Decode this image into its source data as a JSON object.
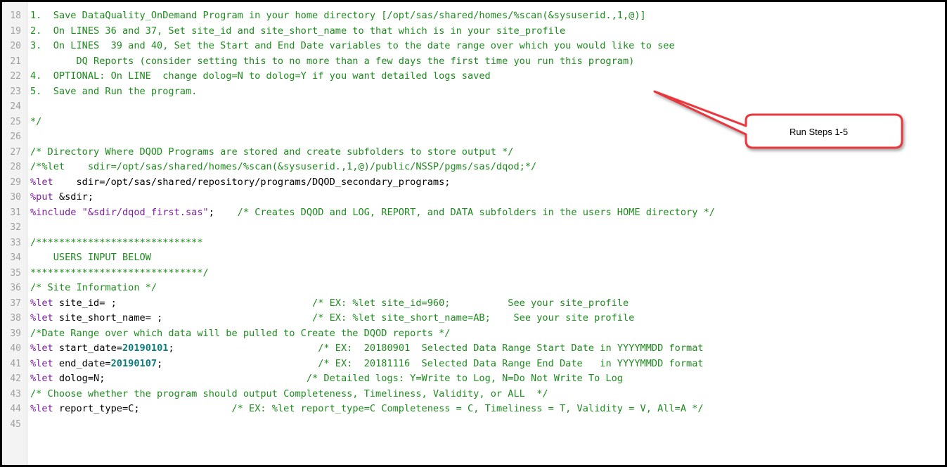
{
  "editor": {
    "lines": [
      {
        "n": "18",
        "parts": [
          {
            "t": "c",
            "v": "1.  Save DataQuality_OnDemand Program in your home directory [/opt/sas/shared/homes/%scan(&sysuserid.,1,@)]"
          }
        ]
      },
      {
        "n": "19",
        "parts": [
          {
            "t": "c",
            "v": "2.  On LINES 36 and 37, Set site_id and site_short_name to that which is in your site_profile"
          }
        ]
      },
      {
        "n": "20",
        "parts": [
          {
            "t": "c",
            "v": "3.  On LINES  39 and 40, Set the Start and End Date variables to the date range over which you would like to see"
          }
        ]
      },
      {
        "n": "21",
        "parts": [
          {
            "t": "c",
            "v": "        DQ Reports (consider setting this to no more than a few days the first time you run this program)"
          }
        ]
      },
      {
        "n": "22",
        "parts": [
          {
            "t": "c",
            "v": "4.  OPTIONAL: On LINE  change dolog=N to dolog=Y if you want detailed logs saved"
          }
        ]
      },
      {
        "n": "23",
        "parts": [
          {
            "t": "c",
            "v": "5.  Save and Run the program."
          }
        ]
      },
      {
        "n": "24",
        "parts": []
      },
      {
        "n": "25",
        "parts": [
          {
            "t": "c",
            "v": "*/"
          }
        ]
      },
      {
        "n": "26",
        "parts": []
      },
      {
        "n": "27",
        "parts": [
          {
            "t": "c",
            "v": "/* Directory Where DQOD Programs are stored and create subfolders to store output */"
          }
        ]
      },
      {
        "n": "28",
        "parts": [
          {
            "t": "c",
            "v": "/*%let    sdir=/opt/sas/shared/homes/%scan(&sysuserid.,1,@)/public/NSSP/pgms/sas/dqod;*/"
          }
        ]
      },
      {
        "n": "29",
        "parts": [
          {
            "t": "m",
            "v": "%let"
          },
          {
            "t": "p",
            "v": "    sdir=/opt/sas/shared/repository/programs/DQOD_secondary_programs;"
          }
        ]
      },
      {
        "n": "30",
        "parts": [
          {
            "t": "m",
            "v": "%put"
          },
          {
            "t": "p",
            "v": " &sdir;"
          }
        ]
      },
      {
        "n": "31",
        "parts": [
          {
            "t": "m",
            "v": "%include"
          },
          {
            "t": "p",
            "v": " "
          },
          {
            "t": "s",
            "v": "\"&sdir/dqod_first.sas\""
          },
          {
            "t": "p",
            "v": ";    "
          },
          {
            "t": "c",
            "v": "/* Creates DQOD and LOG, REPORT, and DATA subfolders in the users HOME directory */"
          }
        ]
      },
      {
        "n": "32",
        "parts": []
      },
      {
        "n": "33",
        "parts": [
          {
            "t": "c",
            "v": "/*****************************"
          }
        ]
      },
      {
        "n": "34",
        "parts": [
          {
            "t": "c",
            "v": "    USERS INPUT BELOW"
          }
        ]
      },
      {
        "n": "35",
        "parts": [
          {
            "t": "c",
            "v": "******************************/"
          }
        ]
      },
      {
        "n": "36",
        "parts": [
          {
            "t": "c",
            "v": "/* Site Information */"
          }
        ]
      },
      {
        "n": "37",
        "parts": [
          {
            "t": "m",
            "v": "%let"
          },
          {
            "t": "p",
            "v": " site_id= ;                                  "
          },
          {
            "t": "c",
            "v": "/* EX: %let site_id=960;          See your site_profile"
          }
        ]
      },
      {
        "n": "38",
        "parts": [
          {
            "t": "m",
            "v": "%let"
          },
          {
            "t": "p",
            "v": " site_short_name= ;                          "
          },
          {
            "t": "c",
            "v": "/* EX: %let site_short_name=AB;    See your site profile"
          }
        ]
      },
      {
        "n": "39",
        "parts": [
          {
            "t": "c",
            "v": "/*Date Range over which data will be pulled to Create the DQOD reports */"
          }
        ]
      },
      {
        "n": "40",
        "parts": [
          {
            "t": "m",
            "v": "%let"
          },
          {
            "t": "p",
            "v": " start_date="
          },
          {
            "t": "num",
            "v": "20190101"
          },
          {
            "t": "p",
            "v": ";                         "
          },
          {
            "t": "c",
            "v": "/* EX:  20180901  Selected Data Range Start Date in YYYYMMDD format"
          }
        ]
      },
      {
        "n": "41",
        "parts": [
          {
            "t": "m",
            "v": "%let"
          },
          {
            "t": "p",
            "v": " end_date="
          },
          {
            "t": "num",
            "v": "20190107"
          },
          {
            "t": "p",
            "v": ";                           "
          },
          {
            "t": "c",
            "v": "/* EX:  20181116  Selected Data Range End Date   in YYYYMMDD format"
          }
        ]
      },
      {
        "n": "42",
        "parts": [
          {
            "t": "m",
            "v": "%let"
          },
          {
            "t": "p",
            "v": " dolog=N;                                   "
          },
          {
            "t": "c",
            "v": "/* Detailed logs: Y=Write to Log, N=Do Not Write To Log"
          }
        ]
      },
      {
        "n": "43",
        "parts": [
          {
            "t": "c",
            "v": "/* Choose whether the program should output Completeness, Timeliness, Validity, or ALL  */"
          }
        ]
      },
      {
        "n": "44",
        "parts": [
          {
            "t": "m",
            "v": "%let"
          },
          {
            "t": "p",
            "v": " report_type=C;                "
          },
          {
            "t": "c",
            "v": "/* EX: %let report_type=C Completeness = C, Timeliness = T, Validity = V, All=A */"
          }
        ]
      },
      {
        "n": "45",
        "parts": []
      }
    ]
  },
  "callout": {
    "text": "Run Steps 1-5",
    "color": "#e8383d"
  }
}
